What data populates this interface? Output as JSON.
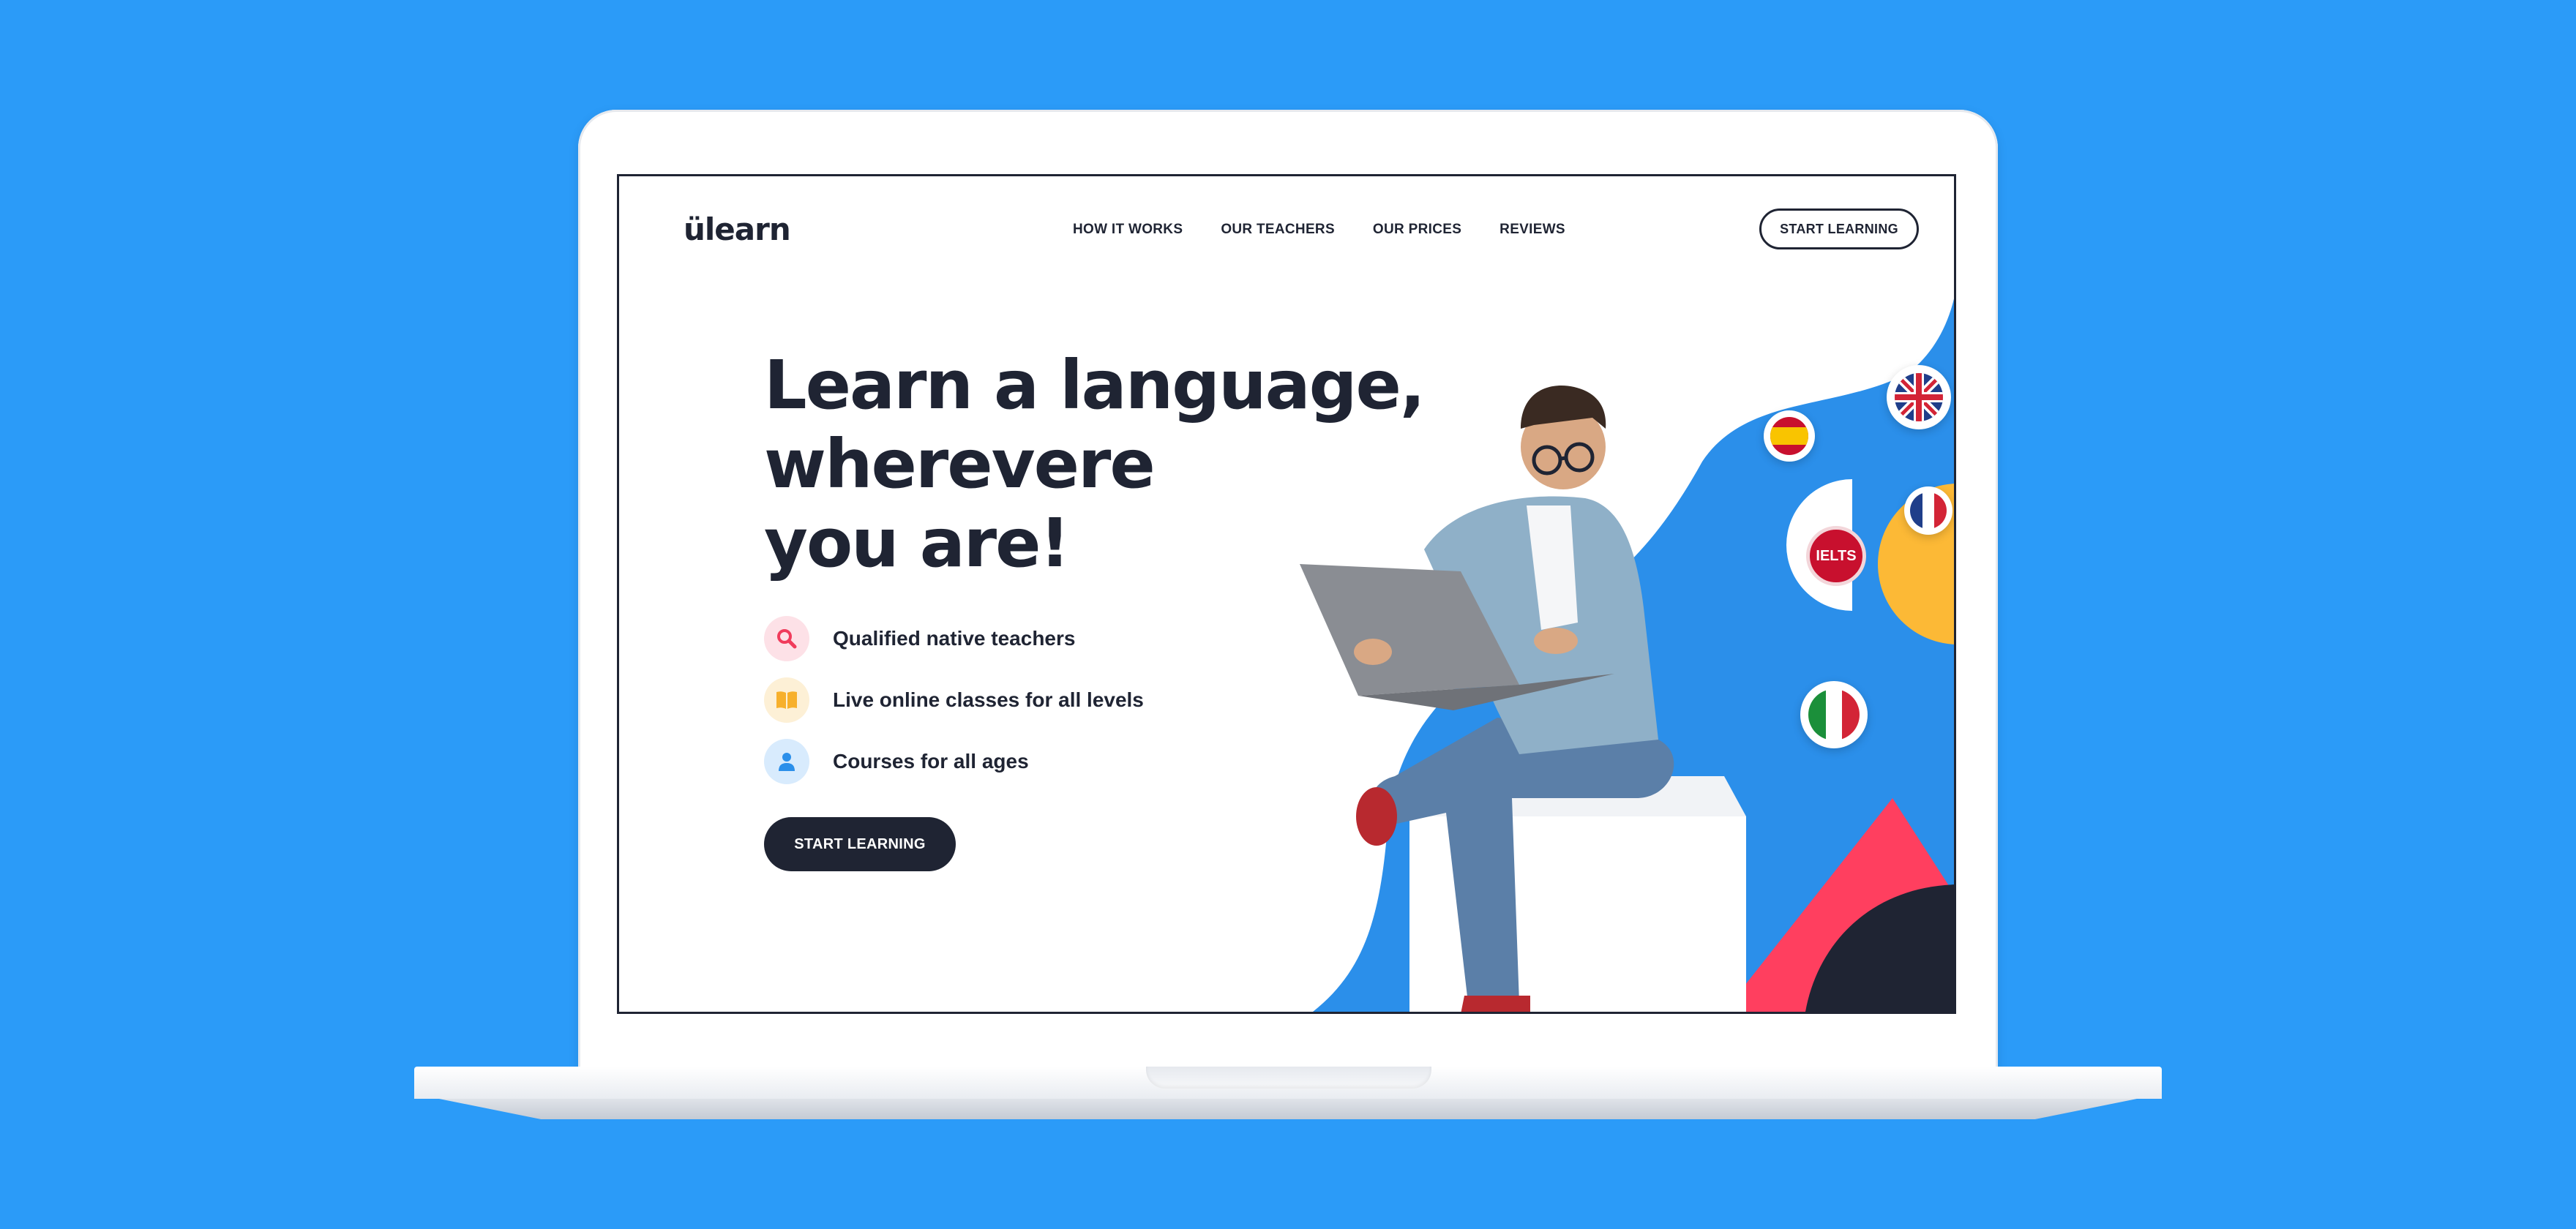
{
  "brand": {
    "logo": "ülearn"
  },
  "nav": {
    "items": [
      "HOW IT WORKS",
      "OUR TEACHERS",
      "OUR PRICES",
      "REVIEWS"
    ],
    "cta": "START LEARNING"
  },
  "hero": {
    "headline": [
      "Learn a language,",
      "wherevere",
      "you are!"
    ],
    "features": [
      {
        "label": "Qualified native teachers",
        "icon": "search-icon",
        "color": "#f03c5c",
        "bg": "#fde1e7"
      },
      {
        "label": "Live online classes for all levels",
        "icon": "book-icon",
        "color": "#f7b02c",
        "bg": "#fdf0d6"
      },
      {
        "label": "Courses for all ages",
        "icon": "person-icon",
        "color": "#2b8fea",
        "bg": "#d8ebfd"
      }
    ],
    "cta": "START LEARNING"
  },
  "badges": {
    "ielts": "IELTS"
  },
  "colors": {
    "background": "#2b9bf8",
    "dark": "#1f2433",
    "pink": "#ff3f5f",
    "yellow": "#fcb936",
    "blue": "#2b8fea"
  }
}
